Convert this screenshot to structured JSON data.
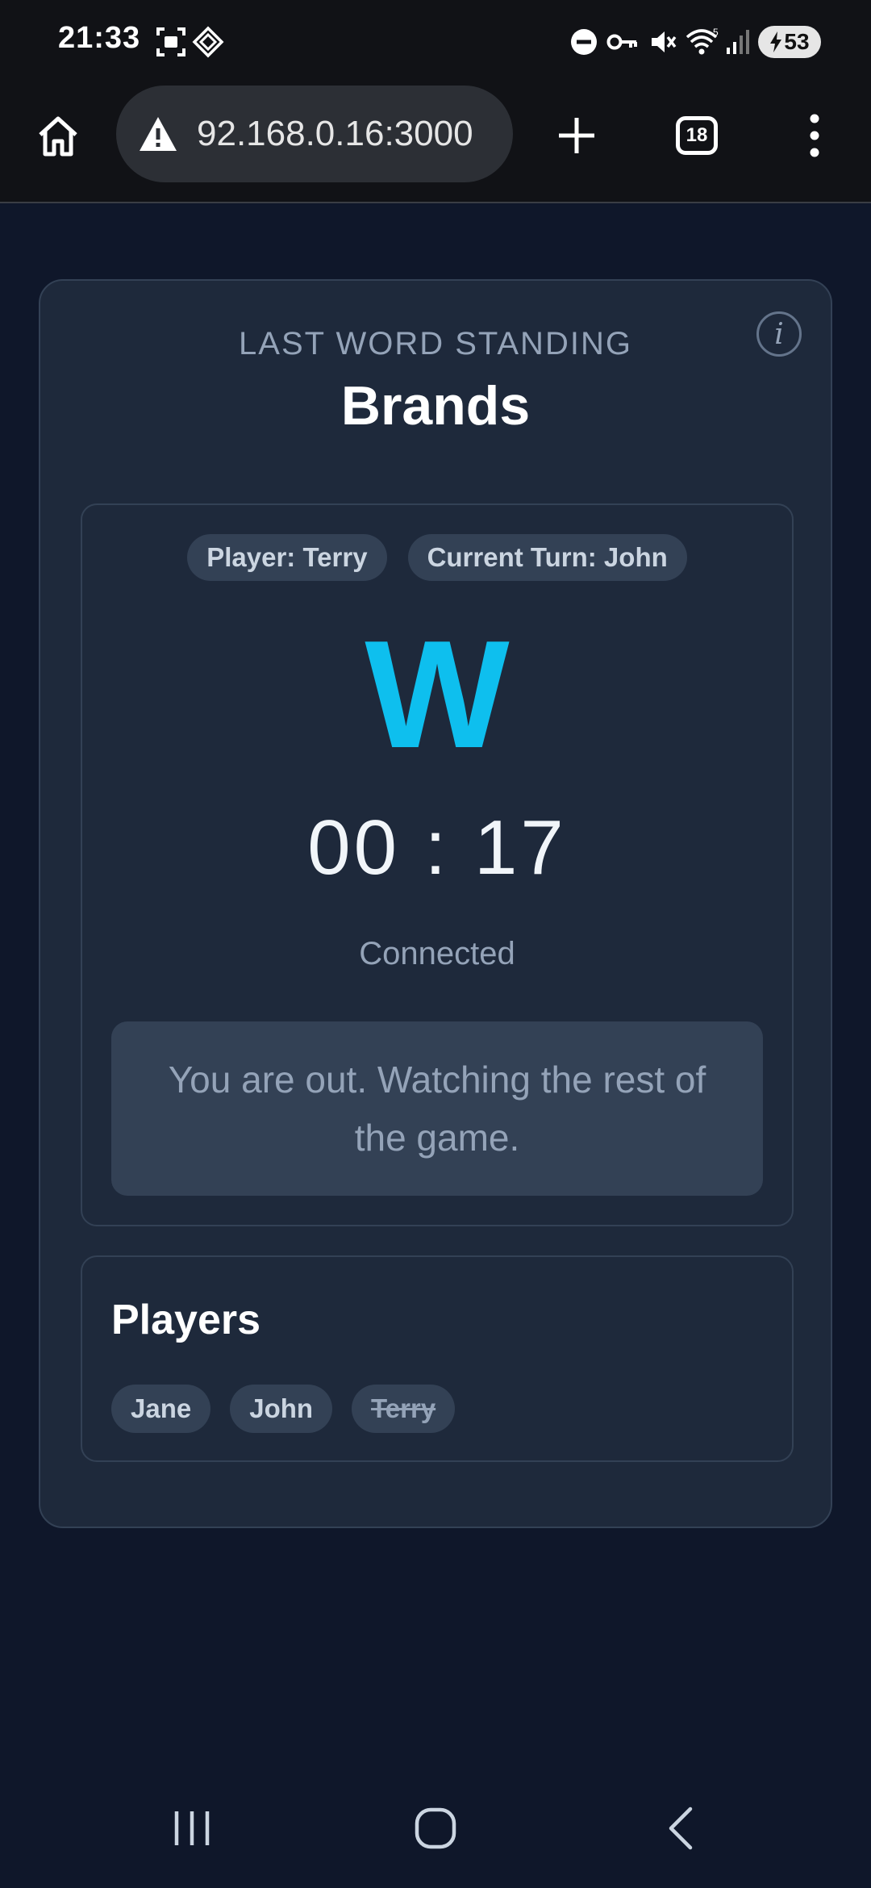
{
  "status_bar": {
    "time": "21:33",
    "battery": "53",
    "icons": [
      "screenshot-icon",
      "vpn-diamond-icon",
      "do-not-disturb-icon",
      "key-icon",
      "mute-icon",
      "wifi-icon",
      "signal-icon",
      "battery-charging-icon"
    ]
  },
  "browser": {
    "url": "92.168.0.16:3000",
    "tab_count": "18",
    "icons": [
      "home-icon",
      "warning-icon",
      "plus-icon",
      "tabs-icon",
      "more-vert-icon"
    ]
  },
  "game": {
    "subtitle": "LAST WORD STANDING",
    "title": "Brands",
    "info_icon": "i",
    "player_badge": "Player: Terry",
    "turn_badge": "Current Turn: John",
    "letter": "W",
    "timer": "00 : 17",
    "connection_status": "Connected",
    "out_message": "You are out. Watching the rest of the game."
  },
  "players": {
    "heading": "Players",
    "list": [
      {
        "name": "Jane",
        "out": false
      },
      {
        "name": "John",
        "out": false
      },
      {
        "name": "Terry",
        "out": true
      }
    ]
  },
  "colors": {
    "page_bg": "#0f172a",
    "card_bg": "#1e293b",
    "accent": "#0ebfee",
    "muted": "#94a3b8"
  }
}
